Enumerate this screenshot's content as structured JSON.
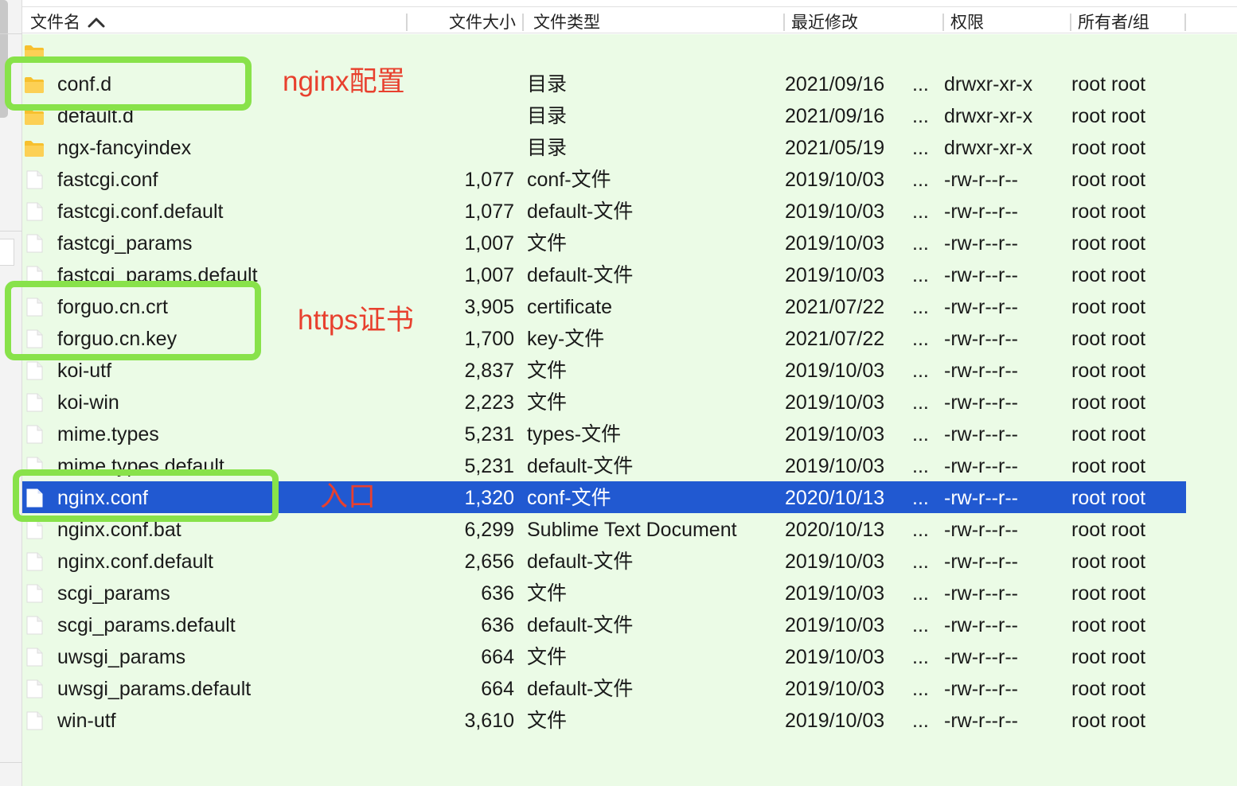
{
  "colors": {
    "row_background": "#ebfbe6",
    "selection": "#2159d1",
    "annotation_box": "#88e24a",
    "annotation_text": "#e8402e",
    "folder": "#f7c02e"
  },
  "header": {
    "columns": [
      "文件名",
      "文件大小",
      "文件类型",
      "最近修改",
      "权限",
      "所有者/组"
    ],
    "sort_icon": "chevron-up-icon"
  },
  "files": [
    {
      "name": "..",
      "size": "",
      "type": "",
      "modified": "",
      "ellipsis": "",
      "perms": "",
      "owner": "",
      "icon": "folder-icon",
      "selected": false
    },
    {
      "name": "conf.d",
      "size": "",
      "type": "目录",
      "modified": "2021/09/16",
      "ellipsis": "...",
      "perms": "drwxr-xr-x",
      "owner": "root root",
      "icon": "folder-icon",
      "selected": false
    },
    {
      "name": "default.d",
      "size": "",
      "type": "目录",
      "modified": "2021/09/16",
      "ellipsis": "...",
      "perms": "drwxr-xr-x",
      "owner": "root root",
      "icon": "folder-icon",
      "selected": false
    },
    {
      "name": "ngx-fancyindex",
      "size": "",
      "type": "目录",
      "modified": "2021/05/19",
      "ellipsis": "...",
      "perms": "drwxr-xr-x",
      "owner": "root root",
      "icon": "folder-icon",
      "selected": false
    },
    {
      "name": "fastcgi.conf",
      "size": "1,077",
      "type": "conf-文件",
      "modified": "2019/10/03",
      "ellipsis": "...",
      "perms": "-rw-r--r--",
      "owner": "root root",
      "icon": "file-icon",
      "selected": false
    },
    {
      "name": "fastcgi.conf.default",
      "size": "1,077",
      "type": "default-文件",
      "modified": "2019/10/03",
      "ellipsis": "...",
      "perms": "-rw-r--r--",
      "owner": "root root",
      "icon": "file-icon",
      "selected": false
    },
    {
      "name": "fastcgi_params",
      "size": "1,007",
      "type": "文件",
      "modified": "2019/10/03",
      "ellipsis": "...",
      "perms": "-rw-r--r--",
      "owner": "root root",
      "icon": "file-icon",
      "selected": false
    },
    {
      "name": "fastcgi_params.default",
      "size": "1,007",
      "type": "default-文件",
      "modified": "2019/10/03",
      "ellipsis": "...",
      "perms": "-rw-r--r--",
      "owner": "root root",
      "icon": "file-icon",
      "selected": false
    },
    {
      "name": "forguo.cn.crt",
      "size": "3,905",
      "type": "certificate",
      "modified": "2021/07/22",
      "ellipsis": "...",
      "perms": "-rw-r--r--",
      "owner": "root root",
      "icon": "file-icon",
      "selected": false
    },
    {
      "name": "forguo.cn.key",
      "size": "1,700",
      "type": "key-文件",
      "modified": "2021/07/22",
      "ellipsis": "...",
      "perms": "-rw-r--r--",
      "owner": "root root",
      "icon": "file-icon",
      "selected": false
    },
    {
      "name": "koi-utf",
      "size": "2,837",
      "type": "文件",
      "modified": "2019/10/03",
      "ellipsis": "...",
      "perms": "-rw-r--r--",
      "owner": "root root",
      "icon": "file-icon",
      "selected": false
    },
    {
      "name": "koi-win",
      "size": "2,223",
      "type": "文件",
      "modified": "2019/10/03",
      "ellipsis": "...",
      "perms": "-rw-r--r--",
      "owner": "root root",
      "icon": "file-icon",
      "selected": false
    },
    {
      "name": "mime.types",
      "size": "5,231",
      "type": "types-文件",
      "modified": "2019/10/03",
      "ellipsis": "...",
      "perms": "-rw-r--r--",
      "owner": "root root",
      "icon": "file-icon",
      "selected": false
    },
    {
      "name": "mime.types.default",
      "size": "5,231",
      "type": "default-文件",
      "modified": "2019/10/03",
      "ellipsis": "...",
      "perms": "-rw-r--r--",
      "owner": "root root",
      "icon": "file-icon",
      "selected": false
    },
    {
      "name": "nginx.conf",
      "size": "1,320",
      "type": "conf-文件",
      "modified": "2020/10/13",
      "ellipsis": "...",
      "perms": "-rw-r--r--",
      "owner": "root root",
      "icon": "file-icon",
      "selected": true
    },
    {
      "name": "nginx.conf.bat",
      "size": "6,299",
      "type": "Sublime Text Document",
      "modified": "2020/10/13",
      "ellipsis": "...",
      "perms": "-rw-r--r--",
      "owner": "root root",
      "icon": "file-icon",
      "selected": false
    },
    {
      "name": "nginx.conf.default",
      "size": "2,656",
      "type": "default-文件",
      "modified": "2019/10/03",
      "ellipsis": "...",
      "perms": "-rw-r--r--",
      "owner": "root root",
      "icon": "file-icon",
      "selected": false
    },
    {
      "name": "scgi_params",
      "size": "636",
      "type": "文件",
      "modified": "2019/10/03",
      "ellipsis": "...",
      "perms": "-rw-r--r--",
      "owner": "root root",
      "icon": "file-icon",
      "selected": false
    },
    {
      "name": "scgi_params.default",
      "size": "636",
      "type": "default-文件",
      "modified": "2019/10/03",
      "ellipsis": "...",
      "perms": "-rw-r--r--",
      "owner": "root root",
      "icon": "file-icon",
      "selected": false
    },
    {
      "name": "uwsgi_params",
      "size": "664",
      "type": "文件",
      "modified": "2019/10/03",
      "ellipsis": "...",
      "perms": "-rw-r--r--",
      "owner": "root root",
      "icon": "file-icon",
      "selected": false
    },
    {
      "name": "uwsgi_params.default",
      "size": "664",
      "type": "default-文件",
      "modified": "2019/10/03",
      "ellipsis": "...",
      "perms": "-rw-r--r--",
      "owner": "root root",
      "icon": "file-icon",
      "selected": false
    },
    {
      "name": "win-utf",
      "size": "3,610",
      "type": "文件",
      "modified": "2019/10/03",
      "ellipsis": "...",
      "perms": "-rw-r--r--",
      "owner": "root root",
      "icon": "file-icon",
      "selected": false
    }
  ],
  "annotations": [
    {
      "label": "nginx配置"
    },
    {
      "label": "https证书"
    },
    {
      "label": "入口"
    }
  ]
}
